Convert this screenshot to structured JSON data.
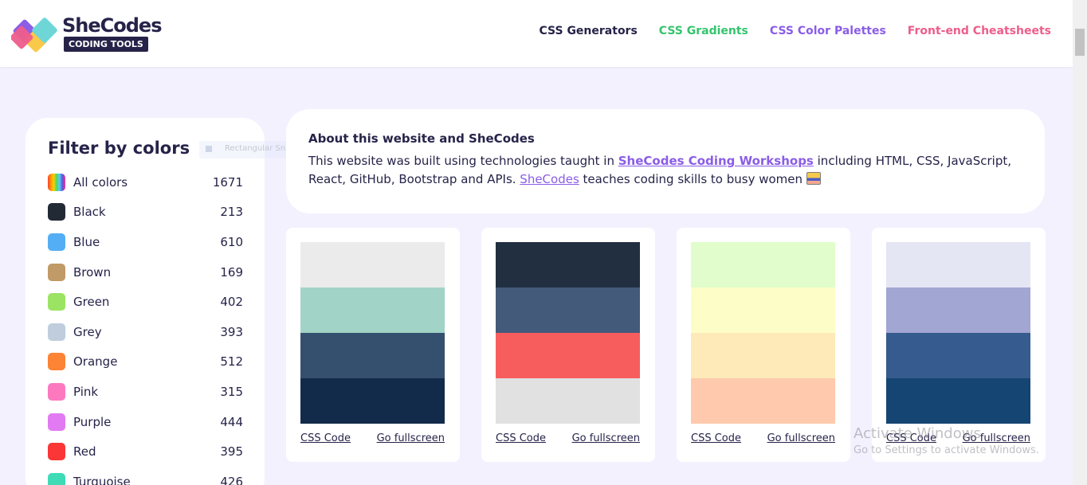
{
  "header": {
    "logo_title": "SheCodes",
    "logo_subtitle": "CODING TOOLS",
    "nav": [
      {
        "label": "CSS Generators",
        "color": "#262349"
      },
      {
        "label": "CSS Gradients",
        "color": "#35c46e"
      },
      {
        "label": "CSS Color Palettes",
        "color": "#8a5de6"
      },
      {
        "label": "Front-end Cheatsheets",
        "color": "#ee5d8b"
      }
    ]
  },
  "sidebar": {
    "title": "Filter by colors",
    "items": [
      {
        "label": "All colors",
        "count": "1671",
        "swatch": "rainbow"
      },
      {
        "label": "Black",
        "count": "213",
        "swatch": "#222a36"
      },
      {
        "label": "Blue",
        "count": "610",
        "swatch": "#54aef5"
      },
      {
        "label": "Brown",
        "count": "169",
        "swatch": "#c09a67"
      },
      {
        "label": "Green",
        "count": "402",
        "swatch": "#9be363"
      },
      {
        "label": "Grey",
        "count": "393",
        "swatch": "#bfcddd"
      },
      {
        "label": "Orange",
        "count": "512",
        "swatch": "#fd8335"
      },
      {
        "label": "Pink",
        "count": "315",
        "swatch": "#fd79bf"
      },
      {
        "label": "Purple",
        "count": "444",
        "swatch": "#e27af3"
      },
      {
        "label": "Red",
        "count": "395",
        "swatch": "#fb3636"
      },
      {
        "label": "Turquoise",
        "count": "426",
        "swatch": "#3edbb6"
      }
    ]
  },
  "snip_ghost": "Rectangular Snip",
  "about": {
    "title": "About this website and SheCodes",
    "text_1": "This website was built using technologies taught in ",
    "link_workshops": "SheCodes Coding Workshops",
    "text_2": " including HTML, CSS, JavaScript, React, GitHub, Bootstrap and APIs. ",
    "link_shecodes": "SheCodes",
    "text_3": " teaches coding skills to busy women "
  },
  "palettes": [
    {
      "colors": [
        "#ebebeb",
        "#a1d3c6",
        "#34506e",
        "#132b4a"
      ],
      "css_label": "CSS Code",
      "full_label": "Go fullscreen"
    },
    {
      "colors": [
        "#222f41",
        "#445a7b",
        "#f85d5d",
        "#e1e1e1"
      ],
      "css_label": "CSS Code",
      "full_label": "Go fullscreen"
    },
    {
      "colors": [
        "#e1fdcb",
        "#fdfdc8",
        "#feeab8",
        "#fec9ad"
      ],
      "css_label": "CSS Code",
      "full_label": "Go fullscreen"
    },
    {
      "colors": [
        "#e5e6f3",
        "#a2a6d3",
        "#365b8f",
        "#154673"
      ],
      "css_label": "CSS Code",
      "full_label": "Go fullscreen"
    }
  ],
  "watermark": {
    "line1": "Activate Windows",
    "line2": "Go to Settings to activate Windows."
  }
}
